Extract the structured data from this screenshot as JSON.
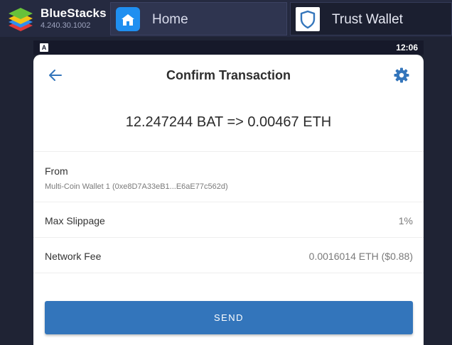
{
  "emulator": {
    "app_name": "BlueStacks",
    "version": "4.240.30.1002",
    "tabs": [
      {
        "label": "Home"
      },
      {
        "label": "Trust Wallet"
      }
    ]
  },
  "android_status": {
    "time": "12:06",
    "notification_icon": "A"
  },
  "screen": {
    "title": "Confirm Transaction",
    "summary": "12.247244 BAT => 0.00467 ETH",
    "from_label": "From",
    "from_value": "Multi-Coin Wallet 1 (0xe8D7A33eB1...E6aE77c562d)",
    "slippage_label": "Max Slippage",
    "slippage_value": "1%",
    "fee_label": "Network Fee",
    "fee_value": "0.0016014 ETH ($0.88)",
    "send_label": "SEND"
  },
  "icons": {
    "back": "arrow-left-icon",
    "settings": "gear-icon",
    "home_tab": "home-icon",
    "trust_tab": "shield-icon"
  },
  "colors": {
    "accent": "#3375bb",
    "titlebar": "#252a40",
    "home_icon": "#1f8ff0"
  }
}
